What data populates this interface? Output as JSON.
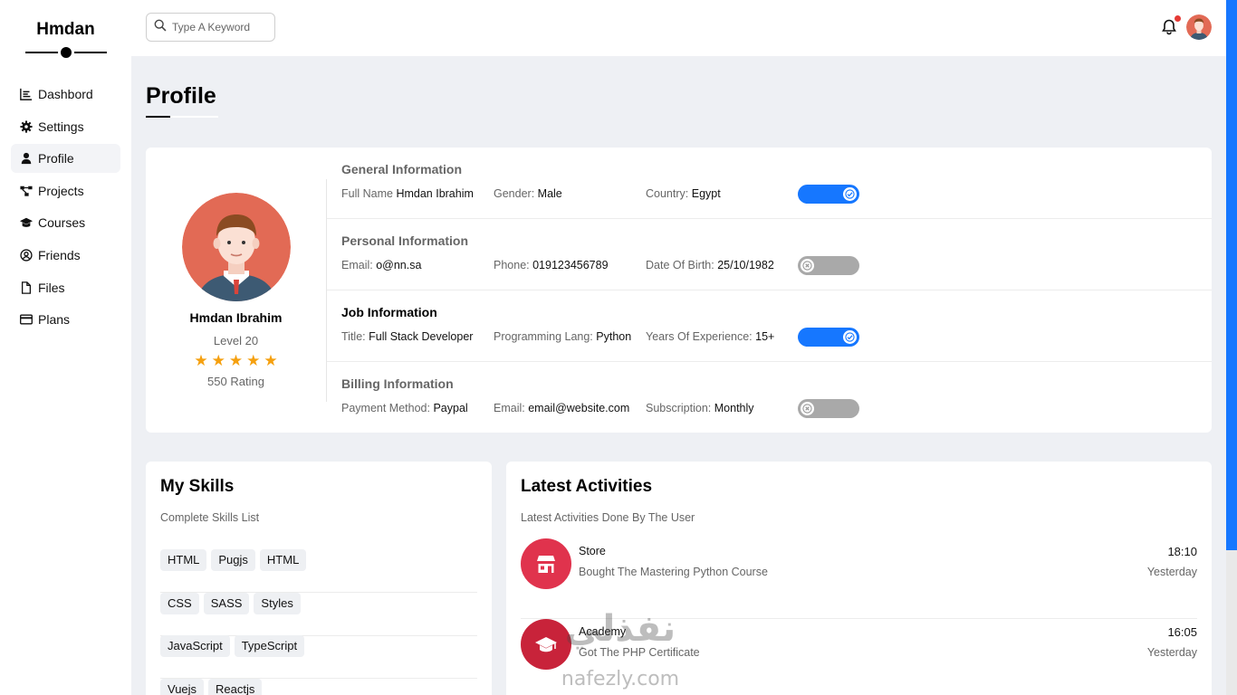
{
  "sidebar": {
    "brand": "Hmdan",
    "items": [
      {
        "label": "Dashbord",
        "icon": "chart-line-icon"
      },
      {
        "label": "Settings",
        "icon": "gear-icon"
      },
      {
        "label": "Profile",
        "icon": "user-icon",
        "active": true
      },
      {
        "label": "Projects",
        "icon": "diagram-icon"
      },
      {
        "label": "Courses",
        "icon": "graduation-cap-icon"
      },
      {
        "label": "Friends",
        "icon": "user-circle-icon"
      },
      {
        "label": "Files",
        "icon": "file-icon"
      },
      {
        "label": "Plans",
        "icon": "credit-card-icon"
      }
    ]
  },
  "topbar": {
    "search_placeholder": "Type A Keyword",
    "has_notification": true
  },
  "page": {
    "title": "Profile"
  },
  "profile_card": {
    "name": "Hmdan Ibrahim",
    "level": "Level 20",
    "stars": 5,
    "rating": "550 Rating"
  },
  "info": [
    {
      "title": "General Information",
      "toggle_on": true,
      "fields": [
        {
          "label": "Full Name",
          "value": "Hmdan Ibrahim"
        },
        {
          "label": "Gender:",
          "value": "Male"
        },
        {
          "label": "Country:",
          "value": "Egypt"
        }
      ]
    },
    {
      "title": "Personal Information",
      "toggle_on": false,
      "fields": [
        {
          "label": "Email:",
          "value": "o@nn.sa"
        },
        {
          "label": "Phone:",
          "value": "019123456789"
        },
        {
          "label": "Date Of Birth:",
          "value": "25/10/1982"
        }
      ]
    },
    {
      "title": "Job Information",
      "toggle_on": true,
      "fields": [
        {
          "label": "Title:",
          "value": "Full Stack Developer"
        },
        {
          "label": "Programming Lang:",
          "value": "Python"
        },
        {
          "label": "Years Of Experience:",
          "value": "15+"
        }
      ]
    },
    {
      "title": "Billing Information",
      "toggle_on": false,
      "fields": [
        {
          "label": "Payment Method:",
          "value": "Paypal"
        },
        {
          "label": "Email:",
          "value": "email@website.com"
        },
        {
          "label": "Subscription:",
          "value": "Monthly"
        }
      ]
    }
  ],
  "skills": {
    "title": "My Skills",
    "subtitle": "Complete Skills List",
    "rows": [
      [
        "HTML",
        "Pugjs",
        "HTML"
      ],
      [
        "CSS",
        "SASS",
        "Styles"
      ],
      [
        "JavaScript",
        "TypeScript"
      ],
      [
        "Vuejs",
        "Reactjs"
      ]
    ]
  },
  "activities": {
    "title": "Latest Activities",
    "subtitle": "Latest Activities Done By The User",
    "items": [
      {
        "title": "Store",
        "desc": "Bought The Mastering Python Course",
        "time": "18:10",
        "day": "Yesterday",
        "icon": "store-icon"
      },
      {
        "title": "Academy",
        "desc": "Got The PHP Certificate",
        "time": "16:05",
        "day": "Yesterday",
        "icon": "graduation-cap-icon"
      }
    ]
  },
  "watermark": {
    "arabic": "نفذلي",
    "latin": "nafezly.com"
  },
  "colors": {
    "accent": "#1677ff",
    "star": "#f5a00f",
    "activity_icon": "#e0334d",
    "notification": "#e53935"
  }
}
